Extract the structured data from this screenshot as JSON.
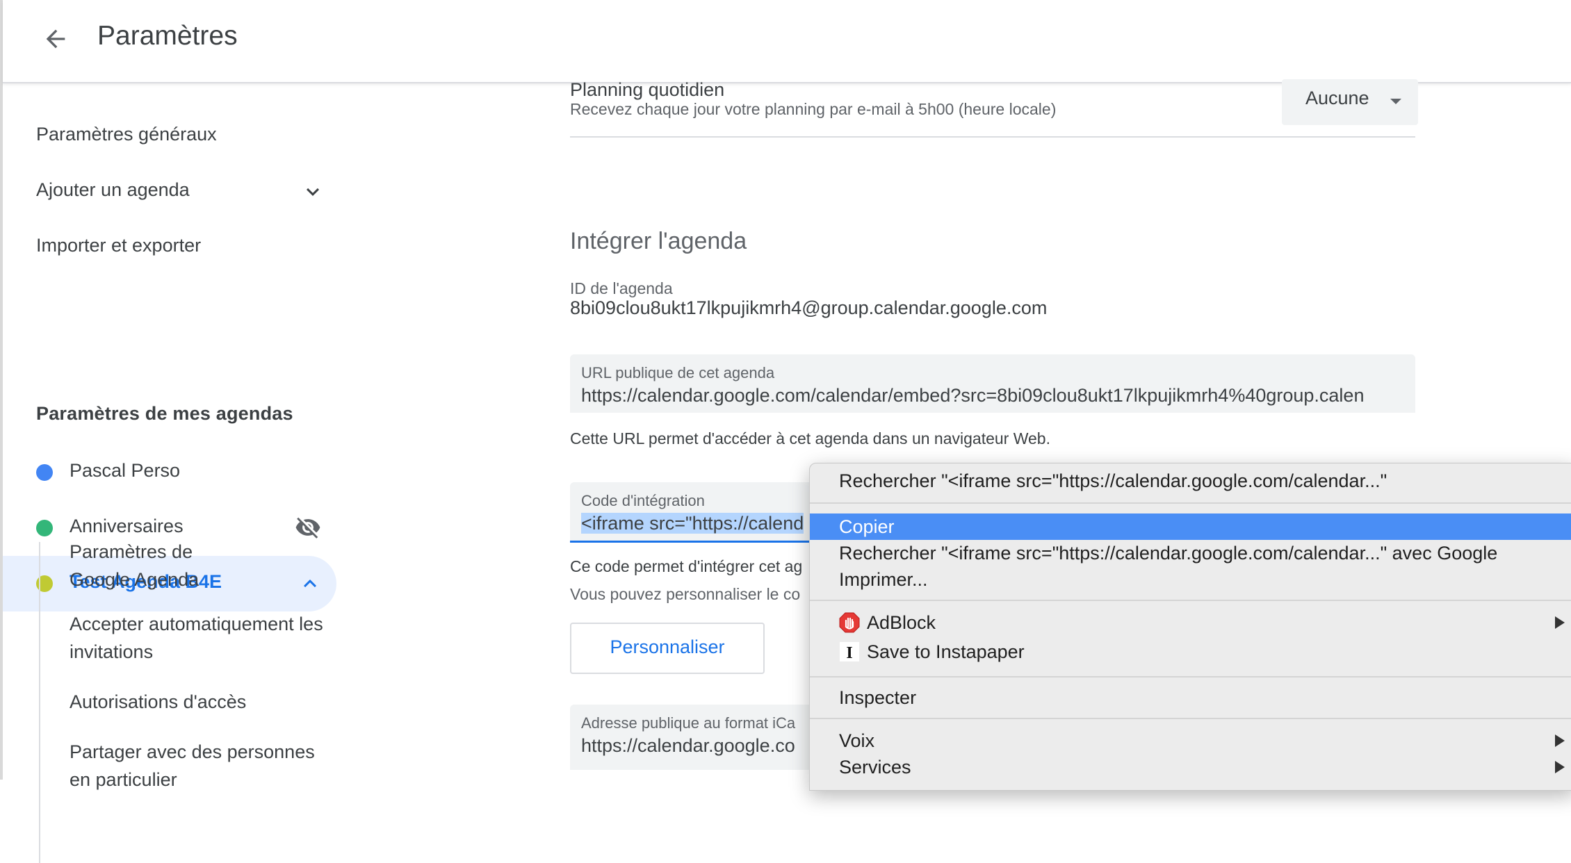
{
  "header": {
    "title": "Paramètres"
  },
  "sidebar": {
    "general": "Paramètres généraux",
    "add_calendar": "Ajouter un agenda",
    "import_export": "Importer et exporter",
    "my_calendars_title": "Paramètres de mes agendas",
    "calendars": [
      {
        "name": "Pascal Perso",
        "color": "#4285f4"
      },
      {
        "name": "Anniversaires",
        "color": "#33b679"
      },
      {
        "name": "Test Agenda B4E",
        "color": "#c0ca33"
      }
    ],
    "sub_items": [
      "Paramètres de\nGoogle Agenda",
      "Accepter automatiquement les invitations",
      "Autorisations d'accès",
      "Partager avec des personnes en particulier"
    ]
  },
  "daily": {
    "title": "Planning quotidien",
    "desc": "Recevez chaque jour votre planning par e-mail à 5h00 (heure locale)",
    "select_value": "Aucune"
  },
  "integrate": {
    "title": "Intégrer l'agenda",
    "id_label": "ID de l'agenda",
    "id_value": "8bi09clou8ukt17lkpujikmrh4@group.calendar.google.com",
    "public_url_label": "URL publique de cet agenda",
    "public_url_value": "https://calendar.google.com/calendar/embed?src=8bi09clou8ukt17lkpujikmrh4%40group.calen",
    "public_url_help": "Cette URL permet d'accéder à cet agenda dans un navigateur Web.",
    "code_label": "Code d'intégration",
    "code_value": "<iframe src=\"https://calend",
    "code_help": "Ce code permet d'intégrer cet ag",
    "code_help2": "Vous pouvez personnaliser le co",
    "customize_button": "Personnaliser",
    "ical_label": "Adresse publique au format iCa",
    "ical_value": "https://calendar.google.co"
  },
  "context_menu": {
    "search": "Rechercher \"<iframe src=\"https://calendar.google.com/calendar...\"",
    "copy": "Copier",
    "search_google": "Rechercher \"<iframe src=\"https://calendar.google.com/calendar...\" avec Google",
    "print": "Imprimer...",
    "adblock": "AdBlock",
    "instapaper": "Save to Instapaper",
    "inspect": "Inspecter",
    "voice": "Voix",
    "services": "Services"
  },
  "colors": {
    "accent": "#1a73e8",
    "menu_highlight": "#4a8ef5"
  }
}
